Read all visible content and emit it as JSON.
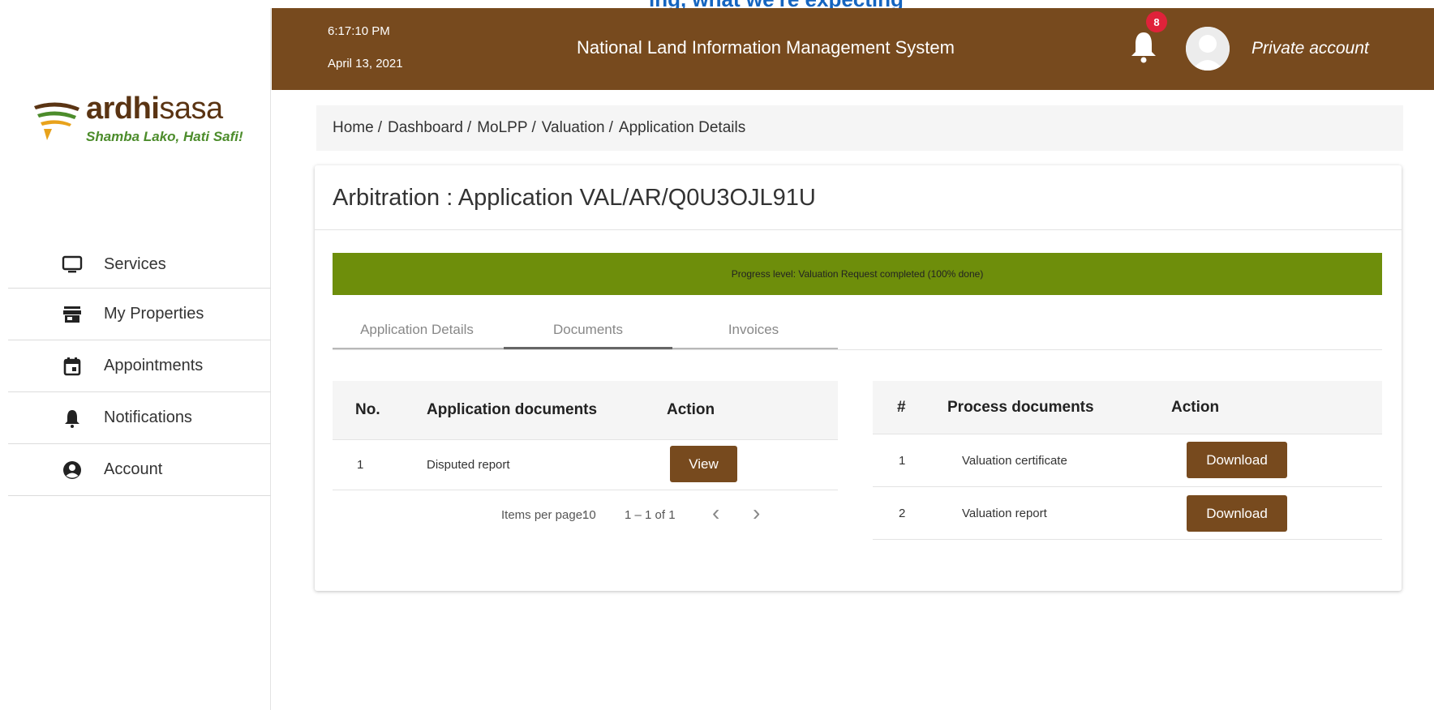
{
  "top_strip": {
    "text": "ing, what we're expecting"
  },
  "brand": {
    "logo_bold": "ardhi",
    "logo_light": "sasa",
    "tagline": "Shamba Lako, Hati Safi!"
  },
  "sidebar": {
    "items": [
      {
        "label": "Services",
        "icon": "monitor-icon"
      },
      {
        "label": "My Properties",
        "icon": "storefront-icon"
      },
      {
        "label": "Appointments",
        "icon": "calendar-icon"
      },
      {
        "label": "Notifications",
        "icon": "bell-icon"
      },
      {
        "label": "Account",
        "icon": "account-circle-icon"
      }
    ]
  },
  "header": {
    "time": "6:17:10 PM",
    "date": "April 13, 2021",
    "title": "National Land Information Management System",
    "notification_count": "8",
    "account_label": "Private account",
    "bg_color": "#774a1e"
  },
  "breadcrumb": [
    "Home",
    "Dashboard",
    "MoLPP",
    "Valuation",
    "Application Details"
  ],
  "page": {
    "title": "Arbitration : Application VAL/AR/Q0U3OJL91U",
    "progress_text": "Progress level: Valuation Request completed (100% done)",
    "progress_percent": 100,
    "progress_color": "#6e8e0b",
    "tabs": [
      {
        "label": "Application Details",
        "active": false
      },
      {
        "label": "Documents",
        "active": true
      },
      {
        "label": "Invoices",
        "active": false
      }
    ]
  },
  "application_documents": {
    "headers": [
      "No.",
      "Application documents",
      "Action"
    ],
    "rows": [
      {
        "no": "1",
        "name": "Disputed report",
        "action": "View"
      }
    ],
    "paginator": {
      "items_per_page_label": "Items per page:",
      "items_per_page": "10",
      "range": "1 – 1 of 1",
      "prev": "‹",
      "next": "›"
    }
  },
  "process_documents": {
    "headers": [
      "#",
      "Process documents",
      "Action"
    ],
    "rows": [
      {
        "no": "1",
        "name": "Valuation certificate",
        "action": "Download"
      },
      {
        "no": "2",
        "name": "Valuation report",
        "action": "Download"
      }
    ]
  }
}
